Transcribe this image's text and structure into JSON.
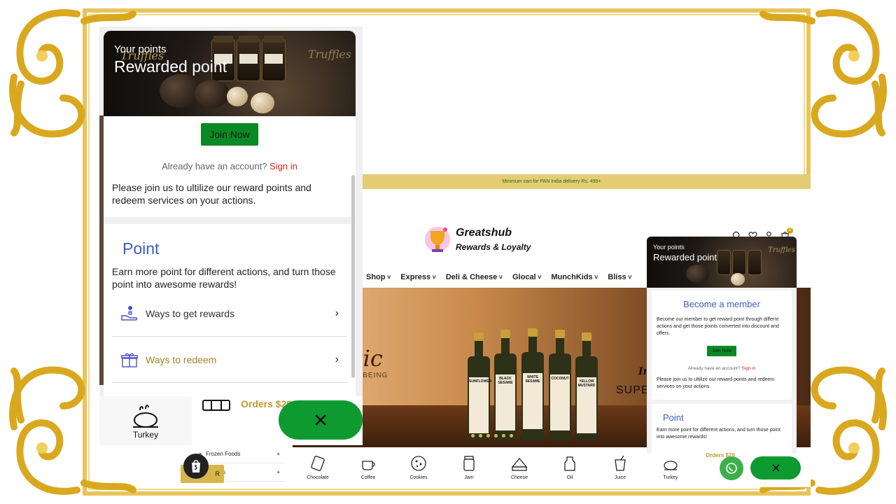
{
  "announcement": "Minimum cart for PAN India delivery Rs. 499+",
  "brand": {
    "line1": "Greatshub",
    "line2": "Rewards & Loyalty"
  },
  "header_icons": [
    "search-icon",
    "heart-icon",
    "user-icon",
    "cart-icon"
  ],
  "cart_count": "0",
  "nav": [
    "Shop",
    "Express",
    "Deli & Cheese",
    "Glocal",
    "MunchKids",
    "Bliss"
  ],
  "hero": {
    "title": "esthetic",
    "subtitle": "RCE OF WELL BEING",
    "right_line1": "In",
    "right_line2": "SUPE",
    "bottles": [
      "SUNFLOWER",
      "BLACK SESAME",
      "WHITE SESAME",
      "COCONUT",
      "YELLOW MUSTARD"
    ],
    "bottle_brand": "HESTHETIC"
  },
  "categories": [
    "Chocolate",
    "Coffee",
    "Cookies",
    "Jam",
    "Cheese",
    "Oil",
    "Juice",
    "Turkey"
  ],
  "sidebar_categories": [
    "Frozen Foods",
    "its"
  ],
  "left_widget": {
    "header_small": "Your points",
    "header_large": "Rewarded point",
    "join_button": "Join Now",
    "already_text": "Already have an account?",
    "signin_link": "Sign in",
    "please_text": "Please join us to ultilize our reward points and redeem services on your actions.",
    "point_title": "Point",
    "point_desc": "Earn more point for different actions, and turn those point into awesome rewards!",
    "ways_get": "Ways to get rewards",
    "ways_redeem": "Ways to redeem",
    "jar_brand": "Truffles"
  },
  "left_below": {
    "category": "Turkey",
    "orders": "Orders $29"
  },
  "right_widget": {
    "header_small": "Your points",
    "header_large": "Rewarded point",
    "title": "Become a member",
    "text": "Become our member to get reward point through differnt actions and get those points converted into discount and offers.",
    "join_button": "Join Now",
    "already_text": "Already have an account?",
    "signin_link": "Sign in",
    "please_text": "Please join us to ultilize our reward points and redeem services on your actions.",
    "point_title": "Point",
    "point_desc": "Earn more point for different actions, and turn those point into awesome rewards!",
    "jar_brand": "Truffles"
  },
  "orders_small": "Orders $29",
  "currency_label": "R",
  "colors": {
    "gold": "#e7c55a",
    "green": "#0d9a31",
    "accent_blue": "#3d5cc9",
    "signin_red": "#d8281f"
  }
}
